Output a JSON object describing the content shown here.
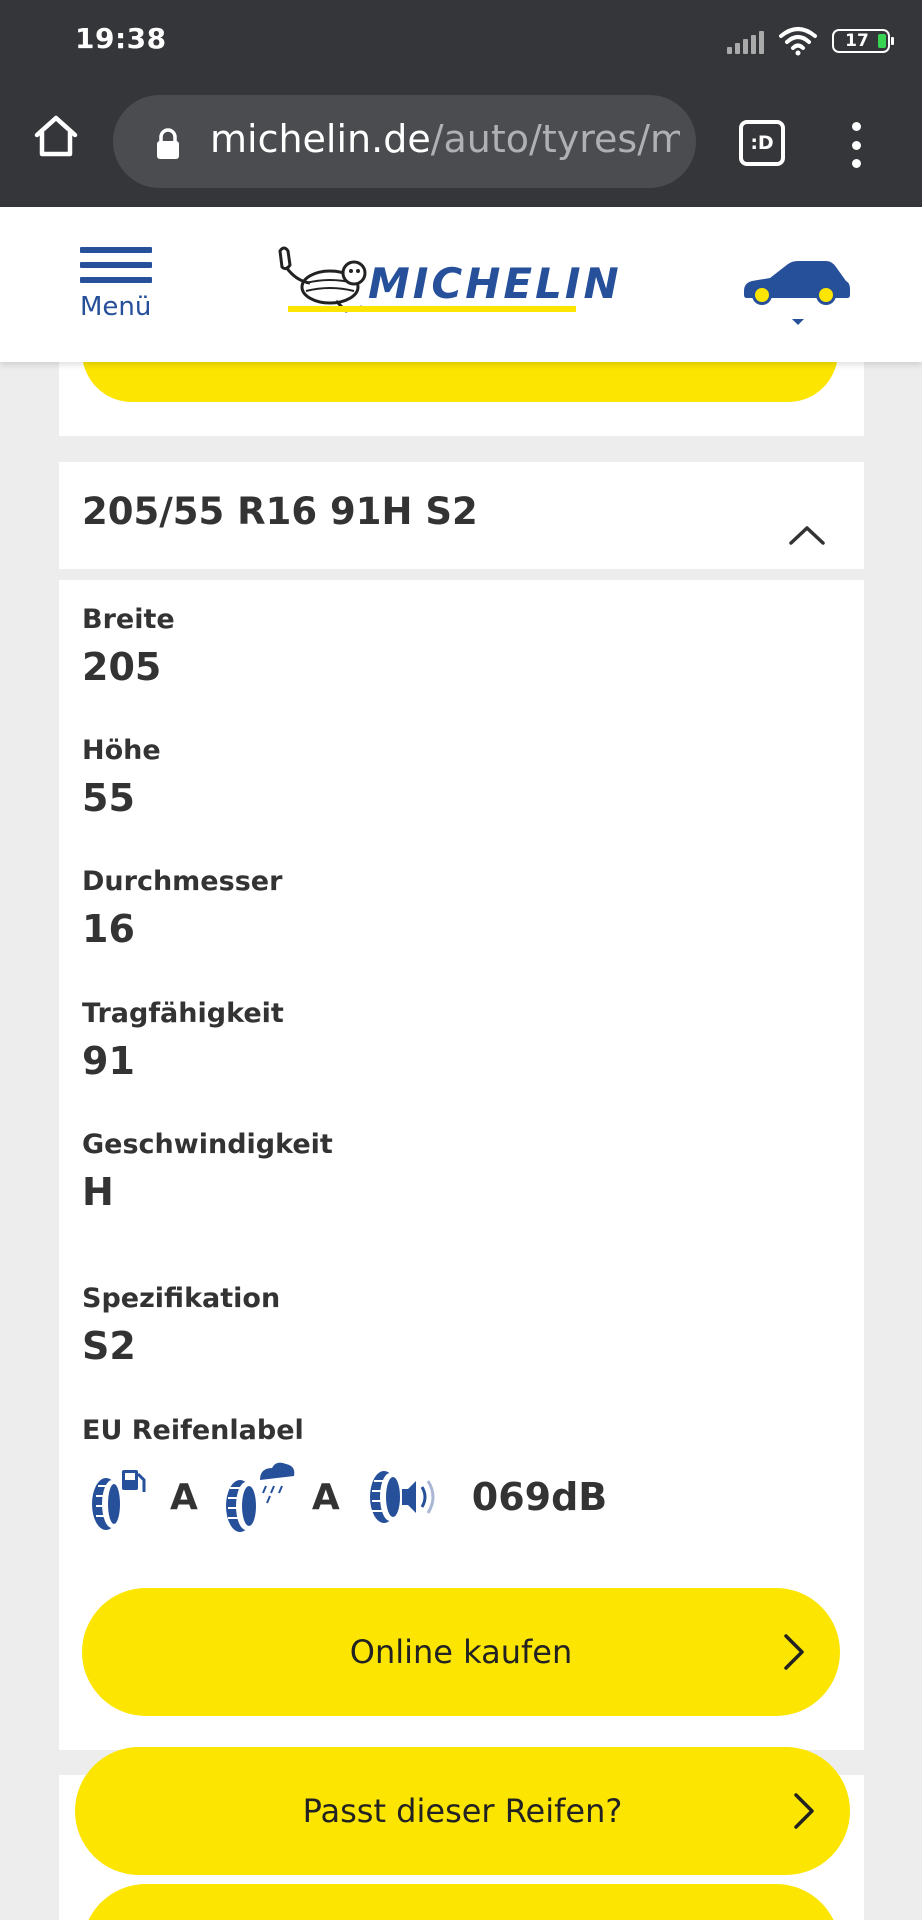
{
  "status_bar": {
    "time": "19:38",
    "battery": "17"
  },
  "browser": {
    "url_domain": "michelin.de",
    "url_path": "/auto/tyres/mic",
    "tabs_label": ":D"
  },
  "header": {
    "menu_label": "Menü",
    "logo_text": "MICHELIN"
  },
  "spec": {
    "title": "205/55 R16 91H S2",
    "fields": [
      {
        "label": "Breite",
        "value": "205"
      },
      {
        "label": "Höhe",
        "value": "55"
      },
      {
        "label": "Durchmesser",
        "value": "16"
      },
      {
        "label": "Tragfähigkeit",
        "value": "91"
      },
      {
        "label": "Geschwindigkeit",
        "value": "H"
      },
      {
        "label": "Spezifikation",
        "value": "S2"
      }
    ],
    "eu_label": "EU Reifenlabel",
    "eu_fuel_grade": "A",
    "eu_wet_grade": "A",
    "eu_noise": "069dB"
  },
  "buttons": {
    "buy_online": "Online kaufen",
    "fits_tire": "Passt dieser Reifen?"
  },
  "colors": {
    "brand_blue": "#27509b",
    "brand_yellow": "#fce500"
  }
}
